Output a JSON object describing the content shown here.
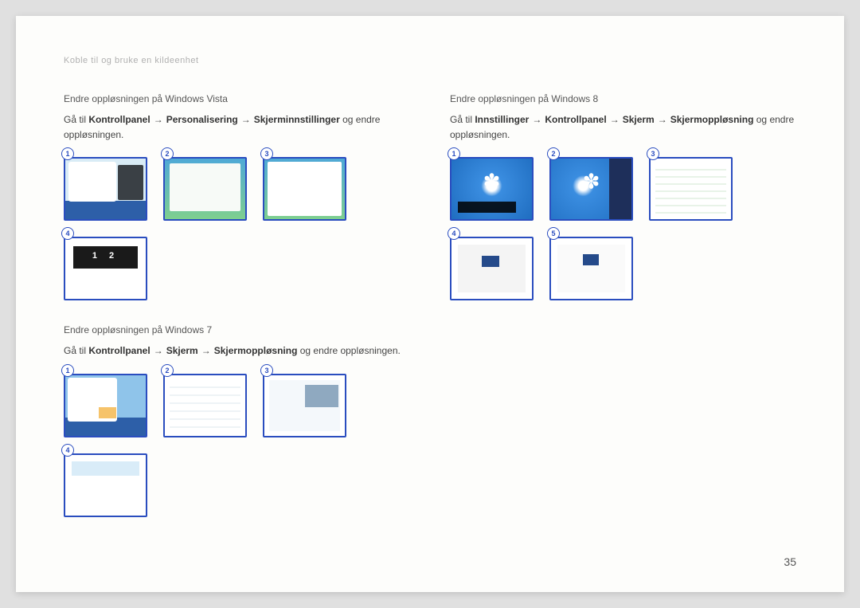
{
  "breadcrumb": "Koble til og bruke en kildeenhet",
  "page_number": "35",
  "arrow": "→",
  "vista": {
    "title": "Endre oppløsningen på Windows Vista",
    "instr_prefix": "Gå til ",
    "step1": "Kontrollpanel",
    "step2": "Personalisering",
    "step3": "Skjerminnstillinger",
    "instr_suffix": " og endre oppløsningen."
  },
  "win7": {
    "title": "Endre oppløsningen på Windows 7",
    "instr_prefix": "Gå til ",
    "step1": "Kontrollpanel",
    "step2": "Skjerm",
    "step3": "Skjermoppløsning",
    "instr_suffix": " og endre oppløsningen."
  },
  "win8": {
    "title": "Endre oppløsningen på Windows 8",
    "instr_prefix": "Gå til ",
    "step1": "Innstillinger",
    "step2": "Kontrollpanel",
    "step3": "Skjerm",
    "step4": "Skjermoppløsning",
    "instr_suffix": " og endre oppløsningen."
  },
  "badges": {
    "n1": "1",
    "n2": "2",
    "n3": "3",
    "n4": "4",
    "n5": "5"
  }
}
